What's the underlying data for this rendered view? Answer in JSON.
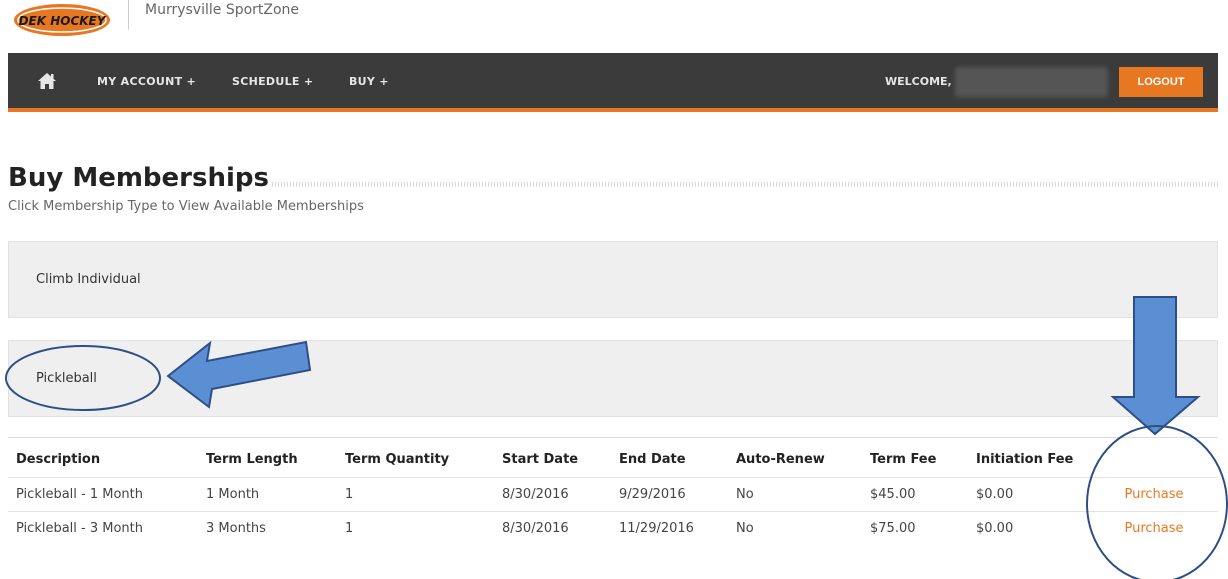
{
  "header": {
    "site_name": "Murrysville SportZone",
    "logo_text": "DEK HOCKEY"
  },
  "nav": {
    "items": [
      {
        "label": "MY ACCOUNT +"
      },
      {
        "label": "SCHEDULE +"
      },
      {
        "label": "BUY +"
      }
    ],
    "welcome_label": "WELCOME,",
    "logout_label": "LOGOUT"
  },
  "page": {
    "title": "Buy Memberships",
    "subtitle": "Click Membership Type to View Available Memberships"
  },
  "membership_types": [
    {
      "label": "Climb Individual"
    },
    {
      "label": "Pickleball"
    }
  ],
  "table": {
    "headers": [
      "Description",
      "Term Length",
      "Term Quantity",
      "Start Date",
      "End Date",
      "Auto-Renew",
      "Term Fee",
      "Initiation Fee",
      ""
    ],
    "rows": [
      {
        "description": "Pickleball - 1 Month",
        "term_length": "1 Month",
        "term_quantity": "1",
        "start_date": "8/30/2016",
        "end_date": "9/29/2016",
        "auto_renew": "No",
        "term_fee": "$45.00",
        "initiation_fee": "$0.00",
        "action": "Purchase"
      },
      {
        "description": "Pickleball - 3 Month",
        "term_length": "3 Months",
        "term_quantity": "1",
        "start_date": "8/30/2016",
        "end_date": "11/29/2016",
        "auto_renew": "No",
        "term_fee": "$75.00",
        "initiation_fee": "$0.00",
        "action": "Purchase"
      }
    ]
  },
  "colors": {
    "accent": "#e87722",
    "navbar": "#3b3b3b",
    "annotation_arrow": "#5b8fd4",
    "annotation_outline": "#2e4e87"
  },
  "icons": {
    "home": "home-icon"
  }
}
